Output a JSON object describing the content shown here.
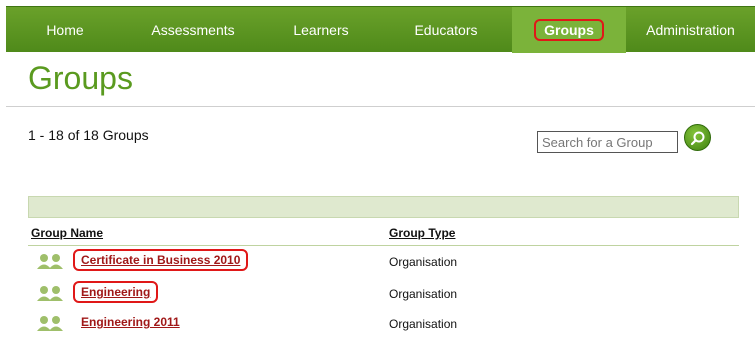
{
  "nav": {
    "items": [
      {
        "label": "Home",
        "active": false
      },
      {
        "label": "Assessments",
        "active": false
      },
      {
        "label": "Learners",
        "active": false
      },
      {
        "label": "Educators",
        "active": false
      },
      {
        "label": "Groups",
        "active": true
      },
      {
        "label": "Administration",
        "active": false
      }
    ]
  },
  "page": {
    "title": "Groups",
    "count_text": "1 - 18 of 18 Groups"
  },
  "search": {
    "placeholder": "Search for a Group",
    "button_icon": "search-icon"
  },
  "table": {
    "columns": [
      "Group Name",
      "Group Type"
    ],
    "rows": [
      {
        "name": "Certificate in Business 2010",
        "type": "Organisation",
        "icon": "group-icon",
        "highlighted": true
      },
      {
        "name": "Engineering",
        "type": "Organisation",
        "icon": "group-icon",
        "highlighted": true
      },
      {
        "name": "Engineering 2011",
        "type": "Organisation",
        "icon": "group-icon",
        "highlighted": false
      }
    ]
  },
  "colors": {
    "nav_green": "#5a9a1f",
    "title_green": "#5a9a1f",
    "link_red": "#a01818",
    "highlight_red": "#e01818",
    "band_green": "#dfe9cf"
  }
}
